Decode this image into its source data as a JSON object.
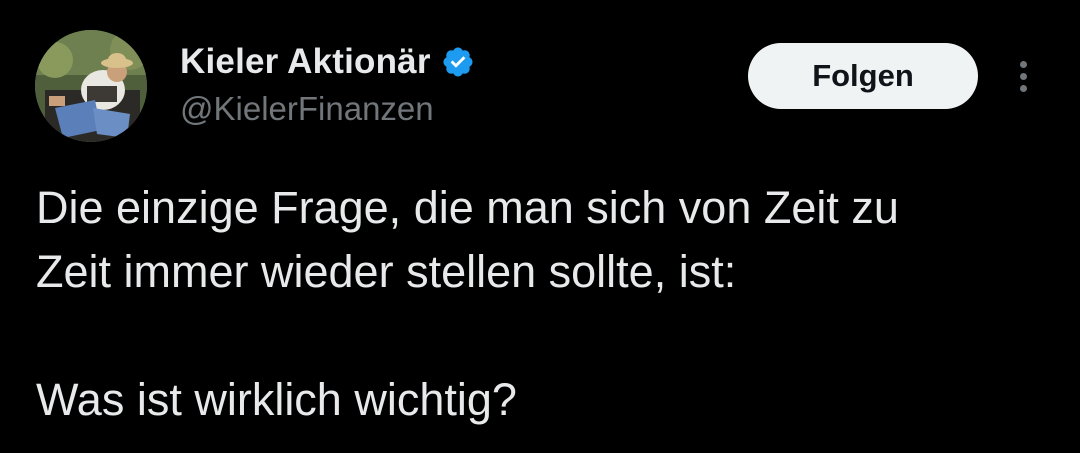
{
  "author": {
    "display_name": "Kieler Aktionär",
    "handle": "@KielerFinanzen",
    "verified": true,
    "verified_icon": "verified-badge-icon",
    "avatar": "avatar-photo"
  },
  "actions": {
    "follow_label": "Folgen",
    "more_icon": "more-options-icon"
  },
  "tweet": {
    "lines": [
      "Die einzige Frage, die man sich von Zeit zu",
      "Zeit immer wieder stellen sollte, ist:",
      "Was ist wirklich wichtig?"
    ]
  },
  "colors": {
    "background": "#000000",
    "text": "#e7e9ea",
    "secondary_text": "#71767b",
    "verified_blue": "#1d9bf0",
    "button_bg": "#eff3f4"
  }
}
